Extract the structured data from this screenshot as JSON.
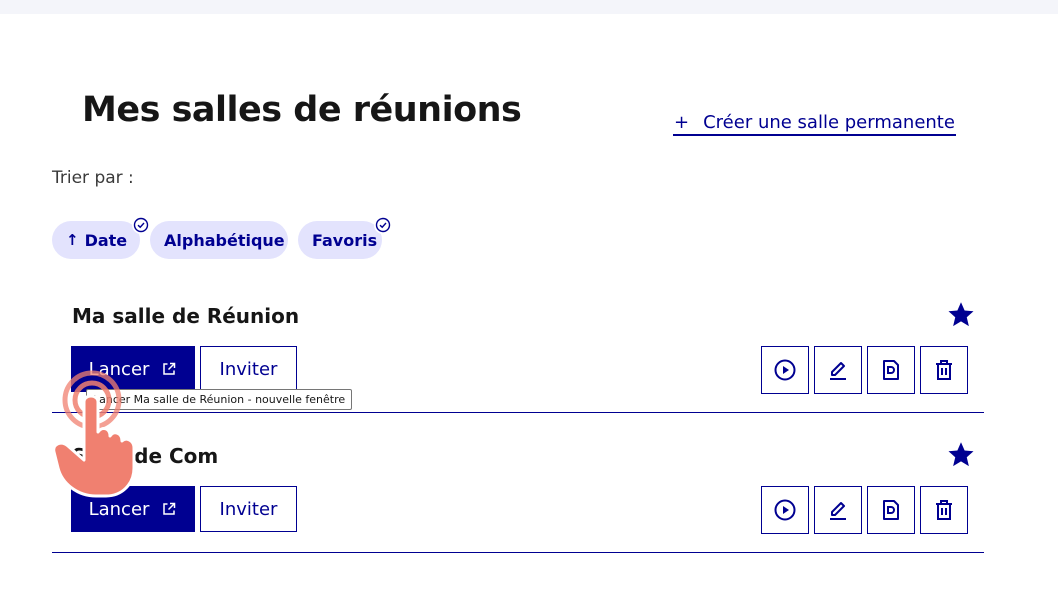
{
  "header": {
    "title": "Mes salles de réunions",
    "create_link": {
      "plus": "+",
      "label": "Créer une salle permanente"
    }
  },
  "sort": {
    "label": "Trier par :",
    "options": [
      {
        "label": "Date",
        "arrow": "↑",
        "selected": true
      },
      {
        "label": "Alphabétique",
        "selected": false
      },
      {
        "label": "Favoris",
        "selected": true
      }
    ]
  },
  "rooms": [
    {
      "name": "Ma salle de Réunion",
      "favorite": true,
      "launch_label": "Lancer",
      "invite_label": "Inviter",
      "actions": [
        "play-icon",
        "edit-icon",
        "document-icon",
        "trash-icon"
      ]
    },
    {
      "name": "Salle de Com",
      "favorite": true,
      "launch_label": "Lancer",
      "invite_label": "Inviter",
      "actions": [
        "play-icon",
        "edit-icon",
        "document-icon",
        "trash-icon"
      ]
    }
  ],
  "tooltip": {
    "text": "Lancer Ma  salle de Réunion - nouvelle fenêtre"
  },
  "colors": {
    "primary": "#000091",
    "tag_bg": "#e3e3fd",
    "topbar": "#f4f5fa",
    "touch_hand": "#f08070"
  }
}
